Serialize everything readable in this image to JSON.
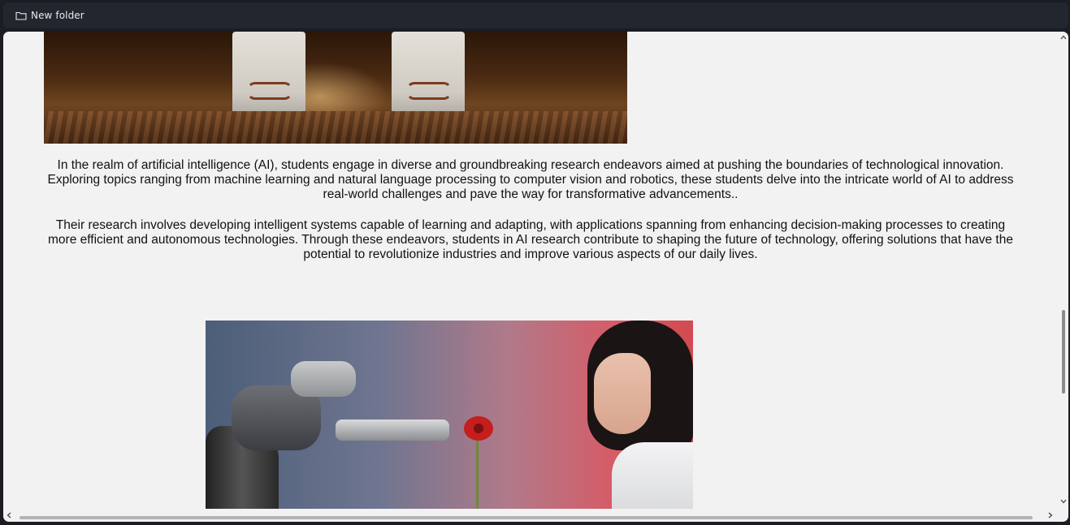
{
  "window": {
    "title": "New folder",
    "title_icon": "folder-icon"
  },
  "images": {
    "top": {
      "name": "robot-legs-image"
    },
    "bottom": {
      "name": "robot-arm-flower-image"
    }
  },
  "article": {
    "paragraphs": [
      "In the realm of artificial intelligence (AI), students engage in diverse and groundbreaking research endeavors aimed at pushing the boundaries of technological innovation. Exploring topics ranging from machine learning and natural language processing to computer vision and robotics, these students delve into the intricate world of AI to address real-world challenges and pave the way for transformative advancements..",
      "Their research involves developing intelligent systems capable of learning and adapting, with applications spanning from enhancing decision-making processes to creating more efficient and autonomous technologies. Through these endeavors, students in AI research contribute to shaping the future of technology, offering solutions that have the potential to revolutionize industries and improve various aspects of our daily lives."
    ]
  },
  "scrollbars": {
    "vertical_icons": [
      "chevron-up-icon",
      "chevron-down-icon"
    ],
    "horizontal_icons": [
      "chevron-left-icon",
      "chevron-right-icon"
    ]
  },
  "colors": {
    "page_background": "#f2f2f2",
    "titlebar": "#22262e",
    "text": "#111111"
  }
}
